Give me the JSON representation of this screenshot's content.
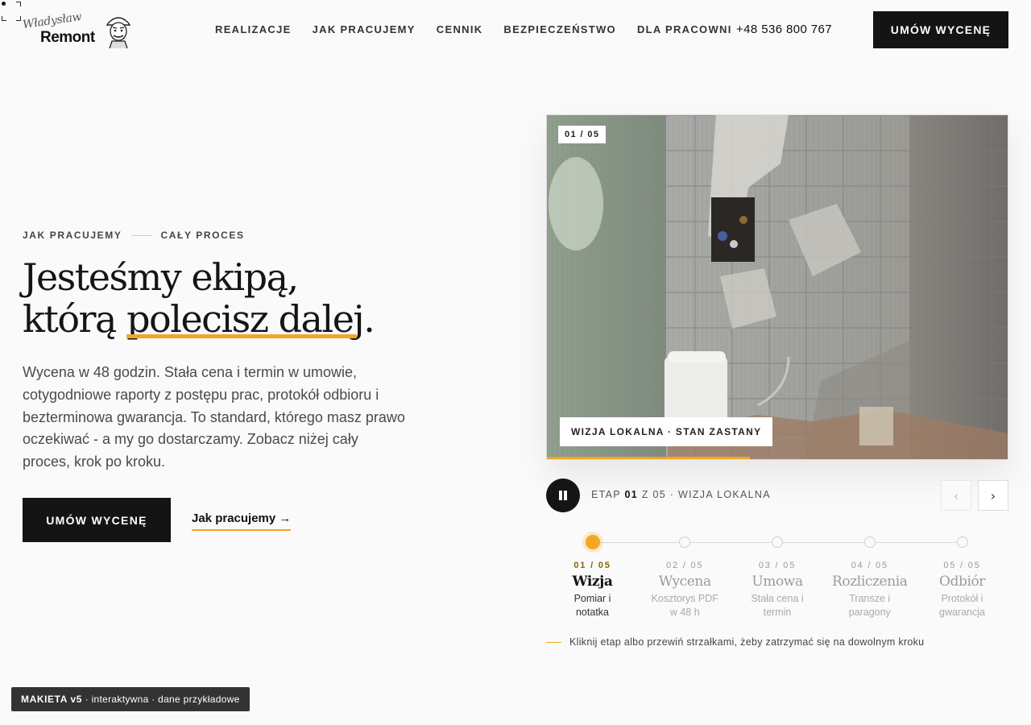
{
  "brand": {
    "script": "Władysław",
    "name": "Remont"
  },
  "nav": {
    "items": [
      "REALIZACJE",
      "JAK PRACUJEMY",
      "CENNIK",
      "BEZPIECZEŃSTWO",
      "DLA PRACOWNI"
    ],
    "phone": "+48 536 800 767",
    "cta": "UMÓW WYCENĘ"
  },
  "hero": {
    "eyebrow_left": "JAK PRACUJEMY",
    "eyebrow_right": "CAŁY PROCES",
    "headline_line1": "Jesteśmy ekipą,",
    "headline_line2_prefix": "którą ",
    "headline_line2_highlight": "polecisz dalej",
    "headline_line2_suffix": ".",
    "lead": "Wycena w 48 godzin. Stała cena i termin w umowie, cotygodniowe raporty z postępu prac, protokół odbioru i bezterminowa gwarancja. To standard, którego masz prawo oczekiwać - a my go dostarczamy. Zobacz niżej cały proces, krok po kroku.",
    "cta_primary": "UMÓW WYCENĘ",
    "cta_secondary": "Jak pracujemy →"
  },
  "slider": {
    "counter": "01 / 05",
    "caption": "WIZJA LOKALNA · STAN ZASTANY",
    "progress": 0.44,
    "stage_prefix": "ETAP",
    "stage_current": "01",
    "stage_suffix": "Z 05 · WIZJA LOKALNA",
    "prev_symbol": "‹",
    "next_symbol": "›",
    "colors": {
      "accent": "#f2a726",
      "dark": "#141414"
    }
  },
  "steps": [
    {
      "num": "01 / 05",
      "title": "Wizja",
      "desc": "Pomiar i notatka",
      "active": true
    },
    {
      "num": "02 / 05",
      "title": "Wycena",
      "desc": "Kosztorys PDF w 48 h",
      "active": false
    },
    {
      "num": "03 / 05",
      "title": "Umowa",
      "desc": "Stała cena i termin",
      "active": false
    },
    {
      "num": "04 / 05",
      "title": "Rozliczenia",
      "desc": "Transze i paragony",
      "active": false
    },
    {
      "num": "05 / 05",
      "title": "Odbiór",
      "desc": "Protokół i gwarancja",
      "active": false
    }
  ],
  "hint": "Kliknij etap albo przewiń strzałkami, żeby zatrzymać się na dowolnym kroku",
  "badge": {
    "strong": "MAKIETA v5",
    "rest": " · interaktywna · dane przykładowe"
  }
}
